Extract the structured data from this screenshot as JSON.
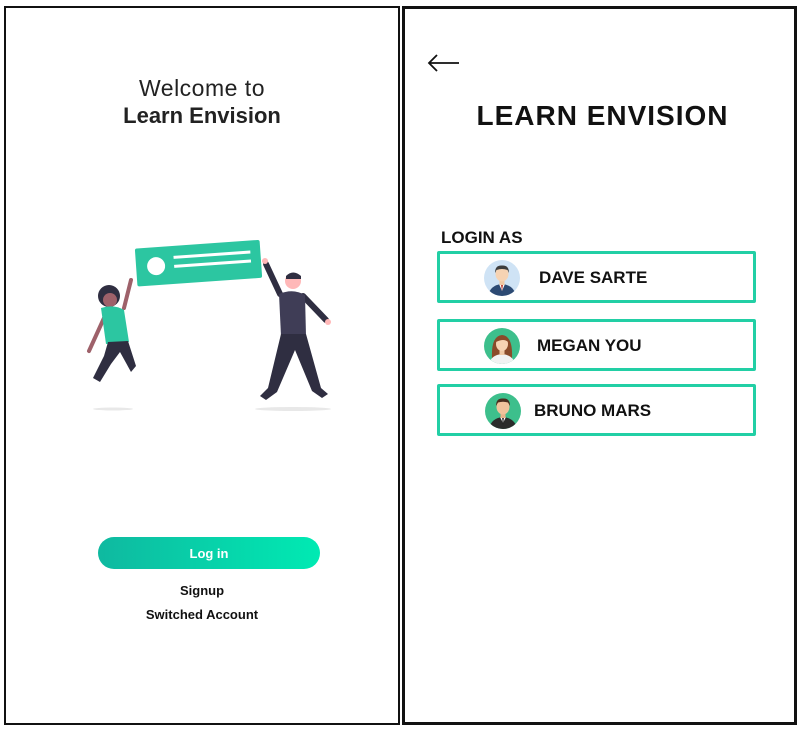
{
  "welcome": {
    "line1": "Welcome to",
    "line2": "Learn Envision"
  },
  "actions": {
    "login_label": "Log in",
    "signup_label": "Signup",
    "switch_label": "Switched Account"
  },
  "header": {
    "back_icon": "arrow-left-icon",
    "title": "LEARN ENVISION"
  },
  "accounts": {
    "heading": "LOGIN AS",
    "users": [
      {
        "name": "DAVE SARTE",
        "avatar_icon": "avatar-man-suit-icon"
      },
      {
        "name": "MEGAN YOU",
        "avatar_icon": "avatar-woman-icon"
      },
      {
        "name": "BRUNO MARS",
        "avatar_icon": "avatar-man-tie-icon"
      }
    ]
  },
  "colors": {
    "accent": "#22cfa5",
    "button_gradient_start": "#0fb9a0",
    "button_gradient_end": "#00eab3",
    "illustration_green": "#2cc6a1",
    "illustration_dark": "#2f2e41"
  }
}
